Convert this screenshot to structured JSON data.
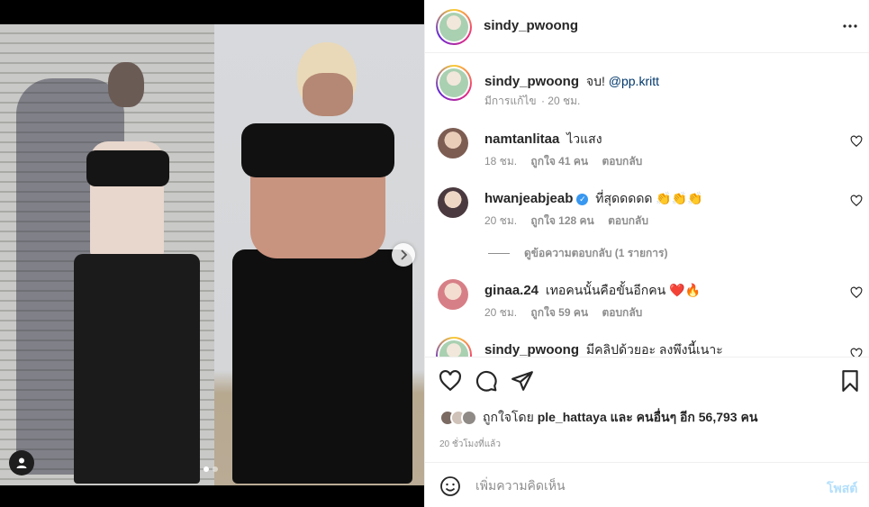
{
  "post": {
    "username": "sindy_pwoong",
    "more_icon": "more-horizontal-icon"
  },
  "caption": {
    "username": "sindy_pwoong",
    "text": "จบ!",
    "mention": "@pp.kritt",
    "edited": "มีการแก้ไข",
    "time": "· 20 ชม."
  },
  "comments": [
    {
      "username": "namtanlitaa",
      "text": "ไวแสง",
      "time": "18 ชม.",
      "likes": "ถูกใจ 41 คน",
      "reply": "ตอบกลับ",
      "avatar_color": "#b48b7a"
    },
    {
      "username": "hwanjeabjeab",
      "verified": "✓",
      "text": "ที่สุดดดดด 👏👏👏",
      "time": "20 ชม.",
      "likes": "ถูกใจ 128 คน",
      "reply": "ตอบกลับ",
      "avatar_color": "#6e5a66"
    },
    {
      "username": "ginaa.24",
      "text": "เทอคนนั้นคือขั้นอีกคน ❤️🔥",
      "time": "20 ชม.",
      "likes": "ถูกใจ 59 คน",
      "reply": "ตอบกลับ",
      "avatar_color": "#c98f8f"
    },
    {
      "username": "sindy_pwoong",
      "text": "มีคลิปด้วยอะ ลงพึงนี้เนาะ"
    }
  ],
  "view_replies": "ดูข้อความตอบกลับ (1 รายการ)",
  "actions": {
    "like_icon": "heart-icon",
    "comment_icon": "comment-icon",
    "share_icon": "share-icon",
    "save_icon": "bookmark-icon"
  },
  "likes": {
    "prefix": "ถูกใจโดย",
    "user": "ple_hattaya",
    "middle": "และ",
    "others": "คนอื่นๆ อีก 56,793 คน"
  },
  "timestamp": "20 ชั่วโมงที่แล้ว",
  "comment_box": {
    "placeholder": "เพิ่มความคิดเห็น",
    "post_label": "โพสต์"
  },
  "colors": {
    "link": "#00376b",
    "muted": "#8e8e8e",
    "post_disabled": "#b2dffc"
  }
}
